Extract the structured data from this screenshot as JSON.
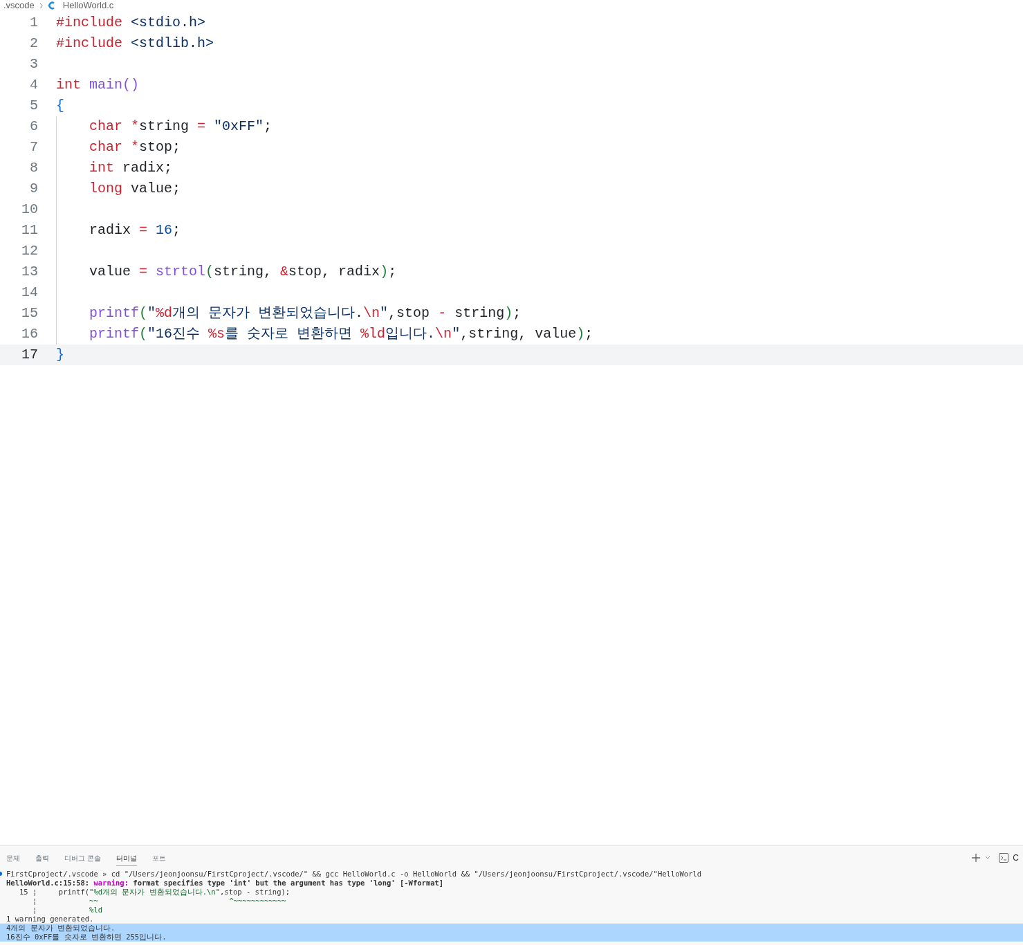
{
  "breadcrumb": [
    {
      "kind": "folder",
      "text": ".vscode"
    },
    {
      "kind": "file",
      "text": "HelloWorld.c"
    }
  ],
  "editor": {
    "lines": [
      {
        "number": "1",
        "current": false,
        "indent": false,
        "tokens": [
          {
            "kind": "keyword",
            "text": "#include"
          },
          {
            "kind": "header",
            "text": " <stdio.h>"
          }
        ]
      },
      {
        "number": "2",
        "current": false,
        "indent": false,
        "tokens": [
          {
            "kind": "keyword",
            "text": "#include"
          },
          {
            "kind": "header",
            "text": " <stdlib.h>"
          }
        ]
      },
      {
        "number": "3",
        "current": false,
        "indent": false
      },
      {
        "number": "4",
        "current": false,
        "indent": false,
        "tokens": [
          {
            "kind": "keyword",
            "text": "int"
          },
          {
            "kind": "func",
            "text": " main()"
          }
        ]
      },
      {
        "number": "5",
        "current": false,
        "indent": false,
        "tokens": [
          {
            "kind": "brace",
            "text": "{"
          }
        ]
      },
      {
        "number": "6",
        "current": false,
        "indent": true,
        "tokens": [
          {
            "kind": "keyword",
            "text": "char *"
          },
          {
            "kind": "plain",
            "text": "string "
          },
          {
            "kind": "keyword",
            "text": "="
          },
          {
            "kind": "string",
            "text": " \"0xFF\""
          },
          {
            "kind": "plain",
            "text": ";"
          }
        ]
      },
      {
        "number": "7",
        "current": false,
        "indent": true,
        "tokens": [
          {
            "kind": "keyword",
            "text": "char *"
          },
          {
            "kind": "plain",
            "text": "stop;"
          }
        ]
      },
      {
        "number": "8",
        "current": false,
        "indent": true,
        "tokens": [
          {
            "kind": "keyword",
            "text": "int"
          },
          {
            "kind": "plain",
            "text": " radix;"
          }
        ]
      },
      {
        "number": "9",
        "current": false,
        "indent": true,
        "tokens": [
          {
            "kind": "keyword",
            "text": "long"
          },
          {
            "kind": "plain",
            "text": " value;"
          }
        ]
      },
      {
        "number": "10",
        "current": false,
        "indent": true
      },
      {
        "number": "11",
        "current": false,
        "indent": true,
        "tokens": [
          {
            "kind": "plain",
            "text": "radix "
          },
          {
            "kind": "keyword",
            "text": "="
          },
          {
            "kind": "number",
            "text": " 16"
          },
          {
            "kind": "plain",
            "text": ";"
          }
        ]
      },
      {
        "number": "12",
        "current": false,
        "indent": true
      },
      {
        "number": "13",
        "current": false,
        "indent": true,
        "tokens": [
          {
            "kind": "plain",
            "text": "value "
          },
          {
            "kind": "keyword",
            "text": "="
          },
          {
            "kind": "func",
            "text": " strtol"
          },
          {
            "kind": "paren",
            "text": "("
          },
          {
            "kind": "plain",
            "text": "string, "
          },
          {
            "kind": "keyword",
            "text": "&"
          },
          {
            "kind": "plain",
            "text": "stop, radix"
          },
          {
            "kind": "paren",
            "text": ")"
          },
          {
            "kind": "plain",
            "text": ";"
          }
        ]
      },
      {
        "number": "14",
        "current": false,
        "indent": true
      },
      {
        "number": "15",
        "current": false,
        "indent": true,
        "tokens": [
          {
            "kind": "func",
            "text": "printf"
          },
          {
            "kind": "paren",
            "text": "("
          },
          {
            "kind": "string",
            "text": "\""
          },
          {
            "kind": "keyword",
            "text": "%d"
          },
          {
            "kind": "string",
            "text": "개의 문자가 변환되었습니다."
          },
          {
            "kind": "keyword",
            "text": "\\n"
          },
          {
            "kind": "string",
            "text": "\""
          },
          {
            "kind": "plain",
            "text": ",stop "
          },
          {
            "kind": "keyword",
            "text": "-"
          },
          {
            "kind": "plain",
            "text": " string"
          },
          {
            "kind": "paren",
            "text": ")"
          },
          {
            "kind": "plain",
            "text": ";"
          }
        ]
      },
      {
        "number": "16",
        "current": false,
        "indent": true,
        "tokens": [
          {
            "kind": "func",
            "text": "printf"
          },
          {
            "kind": "paren",
            "text": "("
          },
          {
            "kind": "string",
            "text": "\"16진수 "
          },
          {
            "kind": "keyword",
            "text": "%s"
          },
          {
            "kind": "string",
            "text": "를 숫자로 변환하면 "
          },
          {
            "kind": "keyword",
            "text": "%ld"
          },
          {
            "kind": "string",
            "text": "입니다."
          },
          {
            "kind": "keyword",
            "text": "\\n"
          },
          {
            "kind": "string",
            "text": "\""
          },
          {
            "kind": "plain",
            "text": ",string, value"
          },
          {
            "kind": "paren",
            "text": ")"
          },
          {
            "kind": "plain",
            "text": ";"
          }
        ]
      },
      {
        "number": "17",
        "current": true,
        "indent": false,
        "tokens": [
          {
            "kind": "brace",
            "text": "}"
          }
        ]
      }
    ]
  },
  "panel": {
    "tabs": [
      {
        "label": "문제",
        "selected": false
      },
      {
        "label": "출력",
        "selected": false
      },
      {
        "label": "디버그 콘솔",
        "selected": false
      },
      {
        "label": "터미널",
        "selected": true
      },
      {
        "label": "포트",
        "selected": false
      }
    ],
    "actions_cut_label": "C",
    "terminal": [
      {
        "selected": false,
        "prompt": true,
        "segments": [
          {
            "kind": "plain",
            "text": "FirstCproject/.vscode » cd \"/Users/jeonjoonsu/FirstCproject/.vscode/\" && gcc HelloWorld.c -o HelloWorld && \"/Users/jeonjoonsu/FirstCproject/.vscode/\"HelloWorld"
          }
        ]
      },
      {
        "selected": false,
        "prompt": false,
        "segments": [
          {
            "kind": "bold",
            "text": "HelloWorld.c:15:58: "
          },
          {
            "kind": "warning",
            "text": "warning: "
          },
          {
            "kind": "bold",
            "text": "format specifies type 'int' but the argument has type 'long' [-Wformat]"
          }
        ]
      },
      {
        "selected": false,
        "prompt": false,
        "segments": [
          {
            "kind": "plain",
            "text": "   15 ¦     printf("
          },
          {
            "kind": "green",
            "text": "\"%d개의 문자가 변환되었습니다.\\n\""
          },
          {
            "kind": "plain",
            "text": ",stop - string);"
          }
        ]
      },
      {
        "selected": false,
        "prompt": false,
        "segments": [
          {
            "kind": "plain",
            "text": "      ¦            "
          },
          {
            "kind": "green",
            "text": "~~                              ^~~~~~~~~~~~~"
          }
        ]
      },
      {
        "selected": false,
        "prompt": false,
        "segments": [
          {
            "kind": "plain",
            "text": "      ¦            "
          },
          {
            "kind": "green",
            "text": "%ld"
          }
        ]
      },
      {
        "selected": false,
        "prompt": false,
        "segments": [
          {
            "kind": "plain",
            "text": "1 warning generated."
          }
        ]
      },
      {
        "selected": true,
        "prompt": false,
        "segments": [
          {
            "kind": "plain",
            "text": "4개의 문자가 변환되었습니다."
          }
        ]
      },
      {
        "selected": true,
        "prompt": false,
        "segments": [
          {
            "kind": "plain",
            "text": "16진수 0xFF를 숫자로 변환하면 255입니다."
          }
        ]
      }
    ]
  }
}
